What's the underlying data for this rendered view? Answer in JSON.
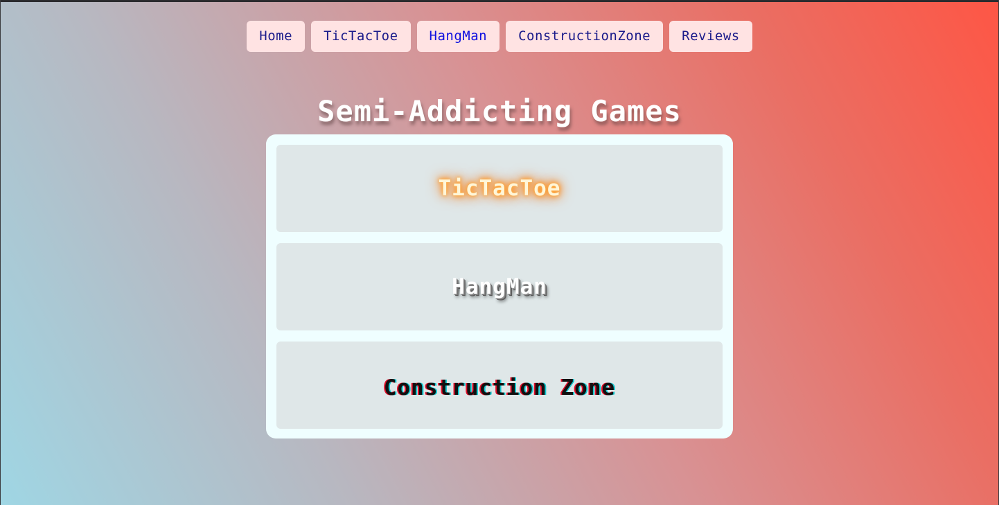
{
  "nav": {
    "items": [
      {
        "label": "Home"
      },
      {
        "label": "TicTacToe"
      },
      {
        "label": "HangMan"
      },
      {
        "label": "ConstructionZone"
      },
      {
        "label": "Reviews"
      }
    ]
  },
  "header": {
    "title": "Semi-Addicting Games"
  },
  "games": [
    {
      "label": "TicTacToe"
    },
    {
      "label": "HangMan"
    },
    {
      "label": "Construction Zone"
    }
  ],
  "colors": {
    "nav_background": "#ffe3e3",
    "nav_text": "#1a1a8a",
    "card_background": "#effeff",
    "tile_background": "#dfe7e8",
    "gradient_start": "#9fd6e4",
    "gradient_end": "#fe5645"
  }
}
